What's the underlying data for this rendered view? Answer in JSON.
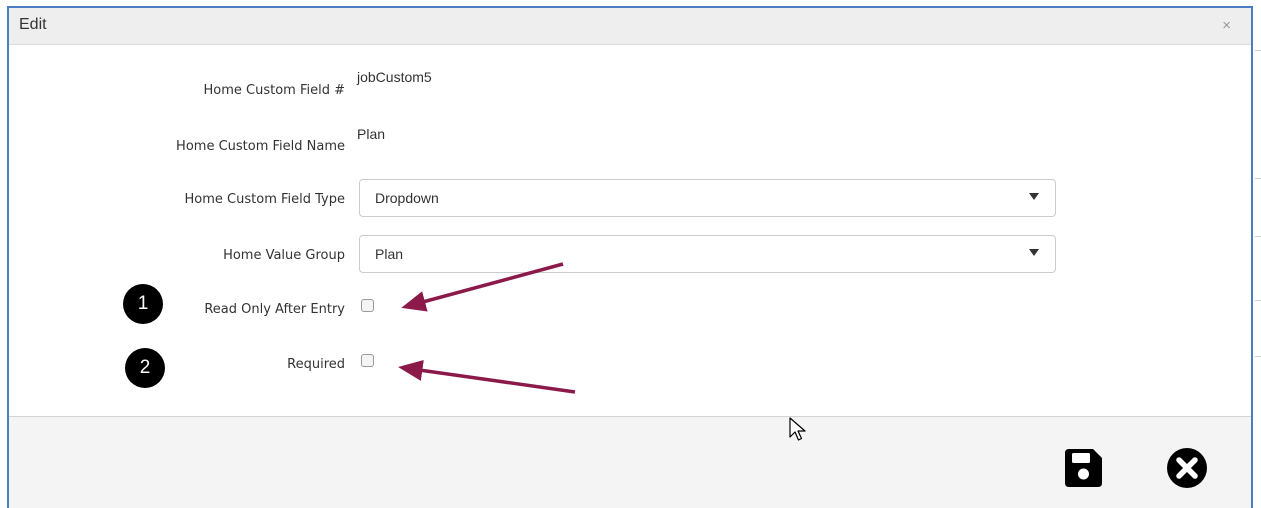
{
  "dialog": {
    "title": "Edit",
    "close_glyph": "×"
  },
  "form": {
    "custom_field_number": {
      "label": "Home Custom Field #",
      "value": "jobCustom5"
    },
    "custom_field_name": {
      "label": "Home Custom Field Name",
      "value": "Plan"
    },
    "custom_field_type": {
      "label": "Home Custom Field Type",
      "value": "Dropdown"
    },
    "value_group": {
      "label": "Home Value Group",
      "value": "Plan"
    },
    "read_only_after_entry": {
      "label": "Read Only After Entry",
      "checked": false
    },
    "required": {
      "label": "Required",
      "checked": false
    }
  },
  "annotations": {
    "badge_1": "1",
    "badge_2": "2",
    "arrow_color": "#8b1a4a"
  },
  "footer": {
    "save_icon": "floppy-disk-save-icon",
    "cancel_icon": "circle-x-cancel-icon"
  },
  "colors": {
    "dialog_border": "#4a7ec2",
    "header_bg": "#eeeeee",
    "footer_bg": "#f4f4f4"
  }
}
